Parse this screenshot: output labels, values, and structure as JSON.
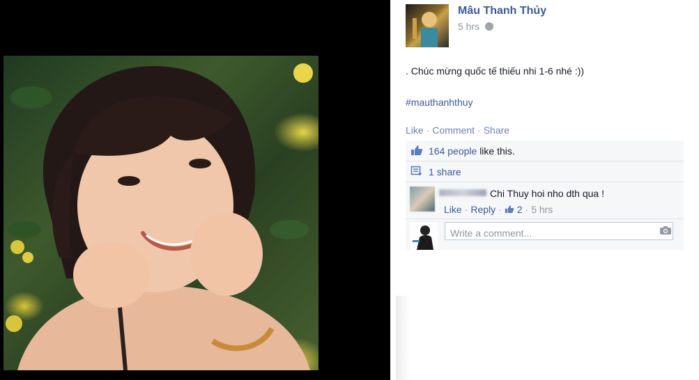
{
  "post": {
    "author": "Mâu Thanh Thủy",
    "timestamp": "5 hrs",
    "text": ". Chúc mừng quốc tế thiếu nhi 1-6 nhé :))",
    "hashtag": "#mauthanhthuy",
    "actions": {
      "like": "Like",
      "comment": "Comment",
      "share": "Share",
      "separator": "·"
    }
  },
  "ufi": {
    "likes": {
      "count_link": "164 people",
      "suffix": "like this."
    },
    "shares": {
      "label": "1 share"
    },
    "comments": [
      {
        "text": "Chi Thuy hoi nho dth qua !",
        "like_label": "Like",
        "reply_label": "Reply",
        "like_count": "2",
        "timestamp": "5 hrs",
        "separator": "·"
      }
    ],
    "composer": {
      "placeholder": "Write a comment..."
    }
  },
  "icons": {
    "privacy": "globe-icon",
    "likes": "thumbs-up-icon",
    "shares": "share-icon",
    "comment_like": "thumbs-up-icon",
    "composer_attach": "camera-icon"
  },
  "colors": {
    "link": "#3b5998",
    "action_link": "#6d84b4",
    "meta_gray": "#90949c",
    "ufi_background": "#f6f7f9"
  }
}
